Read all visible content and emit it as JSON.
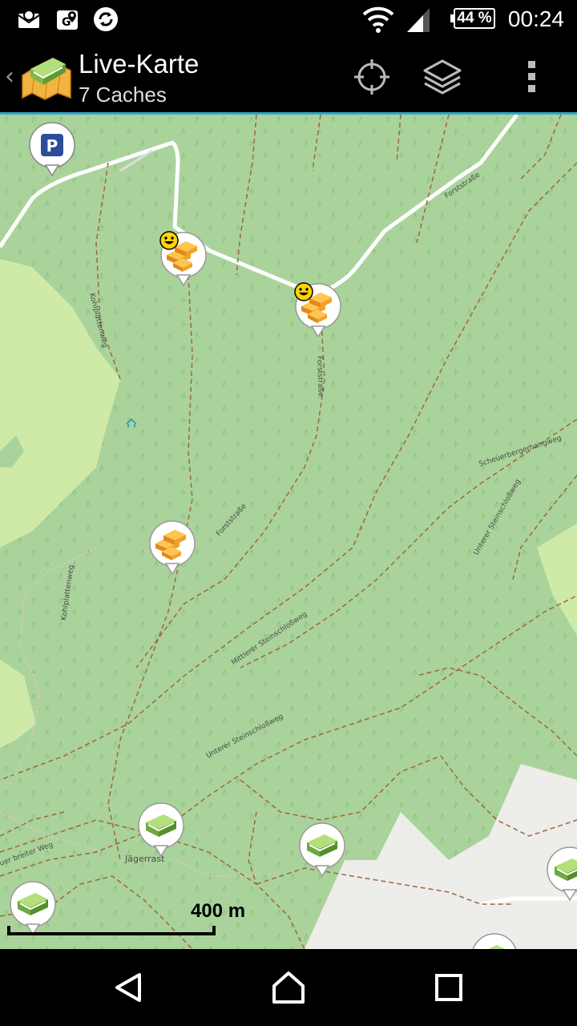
{
  "status_bar": {
    "icons": [
      "mail-icon",
      "map-pin-icon",
      "sync-icon",
      "wifi-icon",
      "signal-icon"
    ],
    "battery": "44 %",
    "time": "00:24"
  },
  "action_bar": {
    "title": "Live-Karte",
    "subtitle": "7 Caches",
    "buttons": [
      "my-location",
      "map-layers",
      "overflow-menu"
    ]
  },
  "map": {
    "street_labels": [
      "Forststraße",
      "Kohlplattenweg",
      "Forststraße",
      "Scheuerbergerhangweg",
      "Forststraße",
      "Unterer Steinschloßweg",
      "Kohlplattenweg",
      "Mittlerer Steinschloßweg",
      "Unterer Steinschloßweg",
      "Jägerrast",
      "uer breiter Weg"
    ],
    "scale": "400 m",
    "caches": [
      {
        "type": "multi-cache",
        "found": true
      },
      {
        "type": "multi-cache",
        "found": true
      },
      {
        "type": "multi-cache",
        "found": false
      },
      {
        "type": "traditional",
        "found": false
      },
      {
        "type": "traditional",
        "found": false
      },
      {
        "type": "traditional",
        "found": false
      },
      {
        "type": "traditional",
        "found": false
      }
    ],
    "parking": "P"
  },
  "colors": {
    "forest": "#a9d39a",
    "meadow": "#cfeaa6",
    "urban": "#ededea",
    "accent": "#34a9c9",
    "track": "#a0663c"
  }
}
